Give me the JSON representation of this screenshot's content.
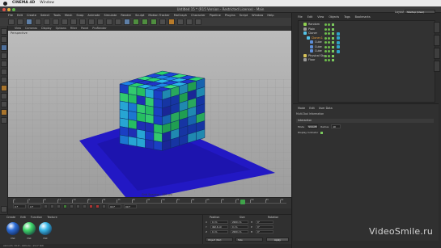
{
  "mac_menu": {
    "app": "CINEMA 4D",
    "window": "Window"
  },
  "window_title": "Untitled 15 * (R15 Version - Restricted License) - Main",
  "app_menu": [
    "File",
    "Edit",
    "Create",
    "Select",
    "Tools",
    "Mesh",
    "Snap",
    "Animate",
    "Simulate",
    "Render",
    "Sculpt",
    "Motion Tracker",
    "MoGraph",
    "Character",
    "Pipeline",
    "Plugins",
    "Script",
    "Window",
    "Help"
  ],
  "viewport_menu": [
    "View",
    "Cameras",
    "Display",
    "Options",
    "Filter",
    "Panel",
    "ProRender"
  ],
  "viewport_label": "Perspective",
  "viewport_scale": "Grid Spacing : 100 cm",
  "timeline": {
    "ticks": [
      "0",
      "5",
      "10",
      "15",
      "20",
      "25",
      "30",
      "35",
      "40",
      "45",
      "50",
      "55",
      "60",
      "65",
      "70",
      "75",
      "80",
      "85",
      "90"
    ],
    "start": "0 F",
    "current": "0 F",
    "end": "90 F",
    "end2": "90 F",
    "playhead_fraction": 0.85
  },
  "materials": {
    "menu": [
      "Create",
      "Edit",
      "Function",
      "Texture"
    ],
    "items": [
      {
        "name": "Mat",
        "color": "#2b6cd6"
      },
      {
        "name": "Mat",
        "color": "#3fd86a"
      },
      {
        "name": "Mat",
        "color": "#38b8e8"
      }
    ]
  },
  "coords": {
    "headers": [
      "Position",
      "Size",
      "Rotation"
    ],
    "rows": [
      {
        "axis": "X",
        "pos": "0 cm",
        "size": "2000 cm",
        "rot_axis": "H",
        "rot": "0°"
      },
      {
        "axis": "Y",
        "pos": "492.6 cm",
        "size": "0 cm",
        "rot_axis": "P",
        "rot": "0°"
      },
      {
        "axis": "Z",
        "pos": "0 cm",
        "size": "2000 cm",
        "rot_axis": "B",
        "rot": "0°"
      }
    ],
    "mode": "Object (Rel)",
    "size_mode": "Size",
    "apply": "Apply"
  },
  "status_text": "Azimuth: 39.6°, Altitude: -19.0°  NW",
  "layout": {
    "label": "Layout:",
    "value": "Startup (User)"
  },
  "objects": {
    "menu": [
      "File",
      "Edit",
      "View",
      "Objects",
      "Tags",
      "Bookmarks"
    ],
    "items": [
      {
        "name": "Random",
        "indent": 1,
        "selected": false
      },
      {
        "name": "Plain",
        "indent": 1,
        "selected": false
      },
      {
        "name": "Cloner",
        "indent": 1,
        "selected": false
      },
      {
        "name": "Cloner.1",
        "indent": 2,
        "selected": true
      },
      {
        "name": "Cube",
        "indent": 3,
        "selected": false
      },
      {
        "name": "Cube",
        "indent": 3,
        "selected": false
      },
      {
        "name": "Cube",
        "indent": 3,
        "selected": false
      },
      {
        "name": "Physical Sky",
        "indent": 1,
        "selected": false
      },
      {
        "name": "Floor",
        "indent": 1,
        "selected": false
      }
    ]
  },
  "attributes": {
    "menu": [
      "Mode",
      "Edit",
      "User Data"
    ],
    "subtitle": "Multi-Tool Information",
    "section": "Interaction",
    "mode_label": "Mode",
    "mode_value": "Smooth",
    "radius_label": "Radius",
    "radius_value": "10",
    "display_label": "Display Indicator"
  },
  "watermark": "VideoSmile.ru"
}
